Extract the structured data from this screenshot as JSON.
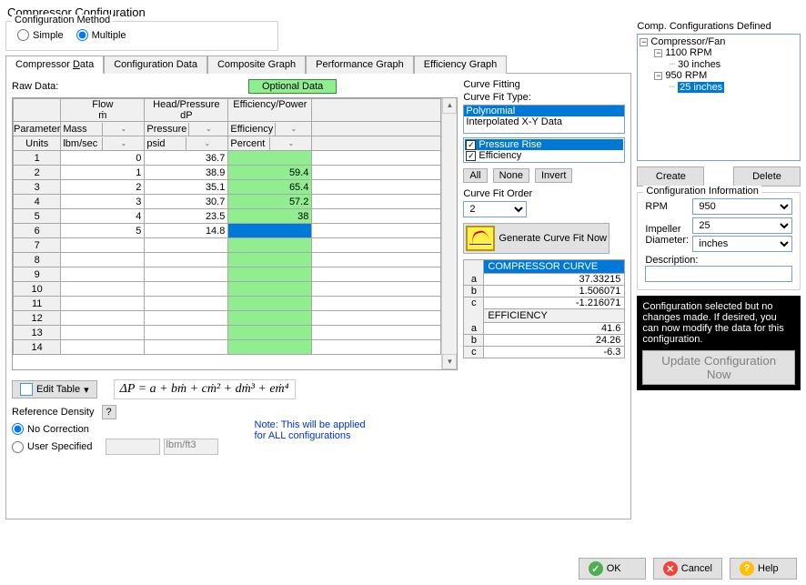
{
  "title": "Compressor Configuration",
  "config_method": {
    "legend": "Configuration Method",
    "simple": "Simple",
    "multiple": "Multiple"
  },
  "tabs": {
    "compressor_data": "Compressor Data",
    "configuration_data": "Configuration Data",
    "composite_graph": "Composite Graph",
    "performance_graph": "Performance Graph",
    "efficiency_graph": "Efficiency Graph"
  },
  "raw_data_label": "Raw Data:",
  "optional_data_label": "Optional Data",
  "grid": {
    "col_flow_top": "Flow",
    "col_flow_sub": "ṁ",
    "col_head_top": "Head/Pressure",
    "col_head_sub": "dP",
    "col_eff_top": "Efficiency/Power",
    "param_label": "Parameter",
    "units_label": "Units",
    "param_flow": "Mass",
    "param_head": "Pressure",
    "param_eff": "Efficiency",
    "units_flow": "lbm/sec",
    "units_head": "psid",
    "units_eff": "Percent",
    "rows": [
      {
        "n": "1",
        "flow": "0",
        "head": "36.7",
        "eff": ""
      },
      {
        "n": "2",
        "flow": "1",
        "head": "38.9",
        "eff": "59.4"
      },
      {
        "n": "3",
        "flow": "2",
        "head": "35.1",
        "eff": "65.4"
      },
      {
        "n": "4",
        "flow": "3",
        "head": "30.7",
        "eff": "57.2"
      },
      {
        "n": "5",
        "flow": "4",
        "head": "23.5",
        "eff": "38"
      },
      {
        "n": "6",
        "flow": "5",
        "head": "14.8",
        "eff": ""
      },
      {
        "n": "7",
        "flow": "",
        "head": "",
        "eff": ""
      },
      {
        "n": "8",
        "flow": "",
        "head": "",
        "eff": ""
      },
      {
        "n": "9",
        "flow": "",
        "head": "",
        "eff": ""
      },
      {
        "n": "10",
        "flow": "",
        "head": "",
        "eff": ""
      },
      {
        "n": "11",
        "flow": "",
        "head": "",
        "eff": ""
      },
      {
        "n": "12",
        "flow": "",
        "head": "",
        "eff": ""
      },
      {
        "n": "13",
        "flow": "",
        "head": "",
        "eff": ""
      },
      {
        "n": "14",
        "flow": "",
        "head": "",
        "eff": ""
      }
    ]
  },
  "edit_table_label": "Edit Table",
  "formula": "ΔP = a + bṁ + cṁ² + dṁ³ + eṁ⁴",
  "ref_density": {
    "label": "Reference Density",
    "no_correction": "No Correction",
    "user_specified": "User Specified",
    "unit": "lbm/ft3",
    "note1": "Note: This will be applied",
    "note2": "for ALL configurations"
  },
  "curve_fitting": {
    "title": "Curve Fitting",
    "fit_type_label": "Curve Fit Type:",
    "polynomial": "Polynomial",
    "interpolated": "Interpolated X-Y Data",
    "pressure_rise": "Pressure Rise",
    "efficiency": "Efficiency",
    "all": "All",
    "none": "None",
    "invert": "Invert",
    "order_label": "Curve Fit Order",
    "order_value": "2",
    "generate": "Generate Curve Fit Now",
    "compressor_curve": "COMPRESSOR CURVE",
    "efficiency_header": "EFFICIENCY",
    "coeffs_comp": [
      {
        "l": "a",
        "v": "37.33215"
      },
      {
        "l": "b",
        "v": "1.506071"
      },
      {
        "l": "c",
        "v": "-1.216071"
      }
    ],
    "coeffs_eff": [
      {
        "l": "a",
        "v": "41.6"
      },
      {
        "l": "b",
        "v": "24.26"
      },
      {
        "l": "c",
        "v": "-6.3"
      }
    ]
  },
  "configs": {
    "title": "Comp. Configurations Defined",
    "root": "Compressor/Fan",
    "n1": "1100 RPM",
    "n1c": "30 inches",
    "n2": "950 RPM",
    "n2c": "25 inches",
    "create": "Create",
    "delete": "Delete"
  },
  "config_info": {
    "legend": "Configuration Information",
    "rpm_label": "RPM",
    "rpm_value": "950",
    "impeller_label": "Impeller Diameter:",
    "impeller_value": "25",
    "impeller_unit": "inches",
    "desc_label": "Description:",
    "desc_value": ""
  },
  "status": "Configuration selected but no changes made. If desired, you can now modify the data for this configuration.",
  "update_btn": "Update Configuration Now",
  "footer": {
    "ok": "OK",
    "cancel": "Cancel",
    "help": "Help",
    "q": "?"
  }
}
